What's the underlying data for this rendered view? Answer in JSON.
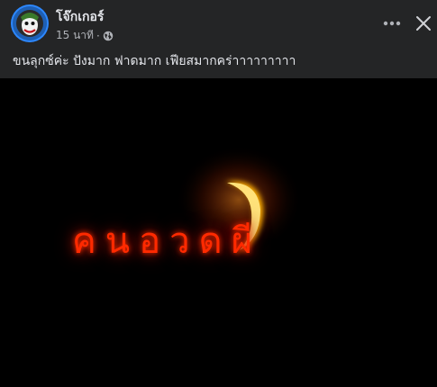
{
  "post": {
    "author_name": "โจ๊กเกอร์",
    "timestamp": "15 นาที",
    "separator": "·",
    "privacy_icon": "globe-icon",
    "caption": "ขนลุกซ์ค่ะ ปังมาก ฟาดมาก เฟียสมากคร่าาาาาาาาา"
  },
  "header_actions": {
    "more_icon": "more-horizontal-icon",
    "close_icon": "close-icon"
  },
  "media": {
    "logo_text": "คนอวดผี",
    "background": "#000000",
    "glow_color": "#ff2a00"
  }
}
